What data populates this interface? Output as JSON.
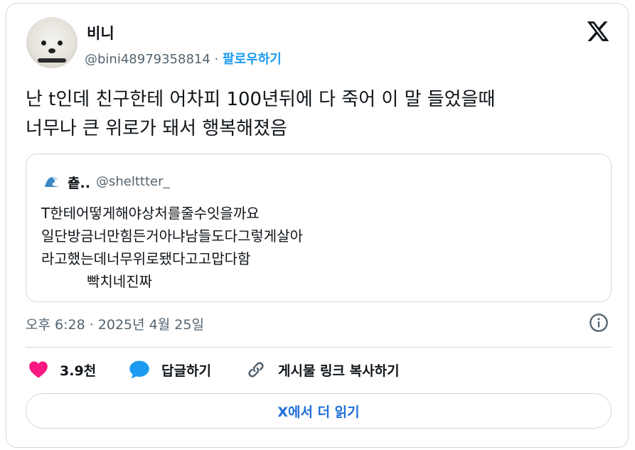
{
  "author": {
    "name": "비니",
    "handle": "@bini48979358814",
    "separator": "·",
    "follow_label": "팔로우하기"
  },
  "icons": {
    "logo": "x-logo",
    "quote_emoji": "wave-icon",
    "info": "info-icon",
    "like": "heart-icon",
    "reply": "speech-bubble-icon",
    "copy_link": "link-icon"
  },
  "tweet": {
    "lines": [
      "난 t인데 친구한테 어차피 100년뒤에 다 죽어 이 말 들었을때",
      "너무나 큰 위로가 돼서 행복해졌음"
    ]
  },
  "quote": {
    "name": "춑..",
    "handle": "@shelttter_",
    "lines": [
      "T한테어떻게해야상처를줄수잇을까요",
      "일단방금너만힘든거아냐남들도다그렇게살아",
      "라고했는데너무위로됐다고고맙다함"
    ],
    "last_line": "빡치네진짜"
  },
  "timestamp": "오후 6:28 · 2025년 4월 25일",
  "actions": {
    "like_count": "3.9천",
    "reply_label": "답글하기",
    "copy_link_label": "게시물 링크 복사하기"
  },
  "read_more_label": "X에서 더 읽기",
  "colors": {
    "accent": "#1d9bf0",
    "like": "#f91880",
    "text_secondary": "#536471",
    "border": "#cfd9de"
  }
}
